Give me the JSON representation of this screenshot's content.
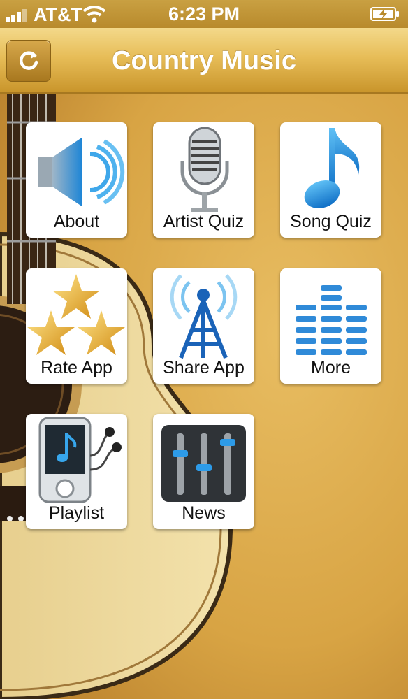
{
  "status_bar": {
    "carrier": "AT&T",
    "time": "6:23 PM"
  },
  "nav": {
    "title": "Country Music",
    "refresh_icon": "refresh-icon"
  },
  "menu": [
    {
      "label": "About",
      "icon": "speaker-icon"
    },
    {
      "label": "Artist Quiz",
      "icon": "microphone-icon"
    },
    {
      "label": "Song Quiz",
      "icon": "music-note-icon"
    },
    {
      "label": "Rate App",
      "icon": "stars-icon"
    },
    {
      "label": "Share App",
      "icon": "broadcast-tower-icon"
    },
    {
      "label": "More",
      "icon": "equalizer-icon"
    },
    {
      "label": "Playlist",
      "icon": "music-player-icon"
    },
    {
      "label": "News",
      "icon": "mixer-sliders-icon"
    }
  ],
  "colors": {
    "nav_gold": "#e7bd58",
    "icon_blue": "#1e8fe0"
  }
}
